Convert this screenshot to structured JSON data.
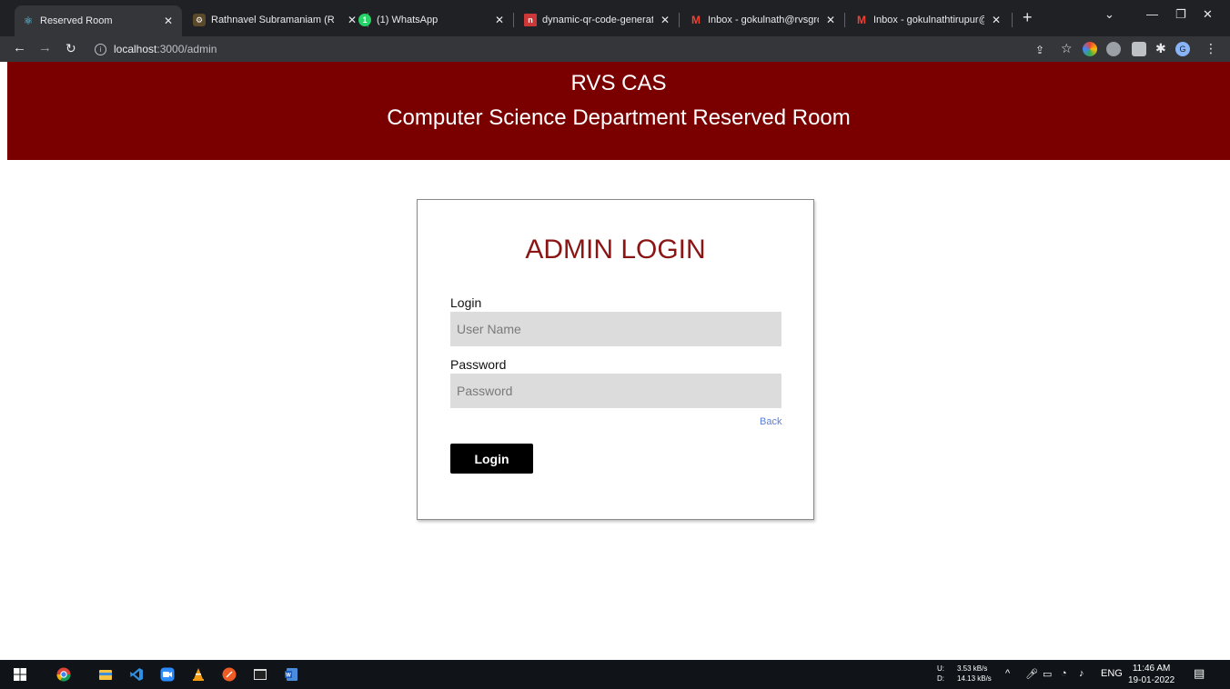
{
  "browser": {
    "tabs": [
      {
        "title": "Reserved Room",
        "active": true
      },
      {
        "title": "Rathnavel Subramaniam (R",
        "active": false
      },
      {
        "title": "(1) WhatsApp",
        "active": false
      },
      {
        "title": "dynamic-qr-code-generato",
        "active": false
      },
      {
        "title": "Inbox - gokulnath@rvsgrou",
        "active": false
      },
      {
        "title": "Inbox - gokulnathtirupur@",
        "active": false
      }
    ],
    "url_host": "localhost",
    "url_path": ":3000/admin"
  },
  "header": {
    "college": "RVS CAS",
    "department": "Computer Science Department Reserved Room"
  },
  "login": {
    "title": "ADMIN LOGIN",
    "username_label": "Login",
    "username_placeholder": "User Name",
    "password_label": "Password",
    "password_placeholder": "Password",
    "back_link": "Back",
    "submit_label": "Login"
  },
  "taskbar": {
    "upload_label": "U:",
    "upload_speed": "3.53 kB/s",
    "download_label": "D:",
    "download_speed": "14.13 kB/s",
    "language": "ENG",
    "time": "11:46 AM",
    "date": "19-01-2022"
  }
}
